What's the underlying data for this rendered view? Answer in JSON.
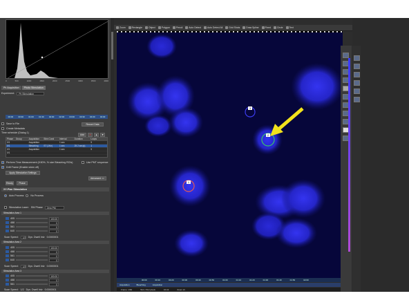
{
  "hist_ticks": [
    "0",
    "500",
    "1000",
    "1500",
    "2000",
    "2500",
    "3000",
    "3500",
    "4000"
  ],
  "tabs": [
    {
      "label": "Ph Acquisition"
    },
    {
      "label": "Photo Stimulation"
    }
  ],
  "experiment": {
    "label": "Experiment:",
    "value": "Ph Stimulation"
  },
  "time_labels": [
    "00:00",
    "00:30",
    "01:00",
    "01:30",
    "02:00",
    "02:30",
    "03:00",
    "03:30",
    "04:00",
    "04:30"
  ],
  "checks": {
    "save_fill": "Save to File",
    "create_metadata": "Create Metadata"
  },
  "record_btn": "Record Data",
  "schedule": {
    "title": "Time schedule (Dialog 1)",
    "add": "Add"
  },
  "table": {
    "headers": [
      "Phase",
      "Group",
      "Acquisition",
      "Stim Cond",
      "Interval",
      "Duration",
      "Loops"
    ],
    "rows": [
      [
        "0/1",
        "",
        "Acquisition",
        "",
        "1 sec",
        "",
        "5"
      ],
      [
        "0/1",
        "",
        "Bleaching",
        "ST (1Hz)",
        "1 sec",
        "25 2 sec(s)",
        "1"
      ],
      [
        "0/1",
        "",
        "Acquisition",
        "",
        "1 sec",
        "",
        "5"
      ],
      [
        "0/1",
        "",
        "",
        "",
        "",
        "",
        ""
      ]
    ]
  },
  "perform_time": "Perform Time Measurement (if 80%, % size Bleaching ROIs)",
  "use_pmt": "Use PMT sequence",
  "drift_check": "Drift Frame (Enable when off)",
  "apply_btn": "Apply Stimulation Settings",
  "advanced_btn": "Advanced >>",
  "ready": {
    "label": "Ready",
    "status": "Phase"
  },
  "xy_title": "XY-Plan Stimulation",
  "modes": {
    "auto": "Auto Process",
    "no_process": "No Process"
  },
  "stim_laser": {
    "label": "Stimulation Laser:",
    "mode": "SW Phase",
    "value": "Zero PM"
  },
  "roi_groups": [
    {
      "title": "Stimulation Area 1",
      "rows": [
        {
          "label": "405",
          "value": "100.00"
        },
        {
          "label": "488",
          "value": "0"
        },
        {
          "label": "561",
          "value": "0"
        },
        {
          "label": "640",
          "value": "0"
        }
      ]
    },
    {
      "title": "Stimulation Area 2",
      "rows": [
        {
          "label": "405",
          "value": "100.00"
        },
        {
          "label": "488",
          "value": "0"
        },
        {
          "label": "561",
          "value": "0"
        },
        {
          "label": "640",
          "value": "0"
        }
      ]
    },
    {
      "title": "Stimulation Area 3",
      "rows": [
        {
          "label": "405",
          "value": "100.00"
        },
        {
          "label": "488",
          "value": "0"
        },
        {
          "label": "561",
          "value": "0"
        },
        {
          "label": "640",
          "value": "0"
        }
      ]
    }
  ],
  "scan_speed": {
    "label": "Scan Speed:",
    "value": "1/2",
    "unit": "Dyn. Dwell Intv",
    "unit2": "0.0000001"
  },
  "manual_btn": "Manual ROI Alignment",
  "toolbar": [
    "Zoom",
    "Rectangle",
    "Object",
    "Polygon",
    "Pencil",
    "Auto Detect",
    "Auto Detect All",
    "Grid Shots",
    "Draw Spline",
    "Fixed",
    "Circle",
    "Text"
  ],
  "rois": [
    {
      "id": "1",
      "color": "#e05858"
    },
    {
      "id": "2",
      "color": "#3ac46a"
    },
    {
      "id": "3",
      "color": "#3d3df2"
    }
  ],
  "arrow_color": "#f2e21c",
  "timeline_labels": [
    "00:00",
    "00:10",
    "00:20",
    "00:30",
    "00:40",
    "00:50",
    "01:00",
    "01:10",
    "01:20",
    "01:30",
    "01:40",
    "01:50",
    "02:00"
  ],
  "statusbar": [
    "Frame: 1/60",
    "512 x 512 pixels",
    "16-bit",
    "Zoom 2x"
  ]
}
